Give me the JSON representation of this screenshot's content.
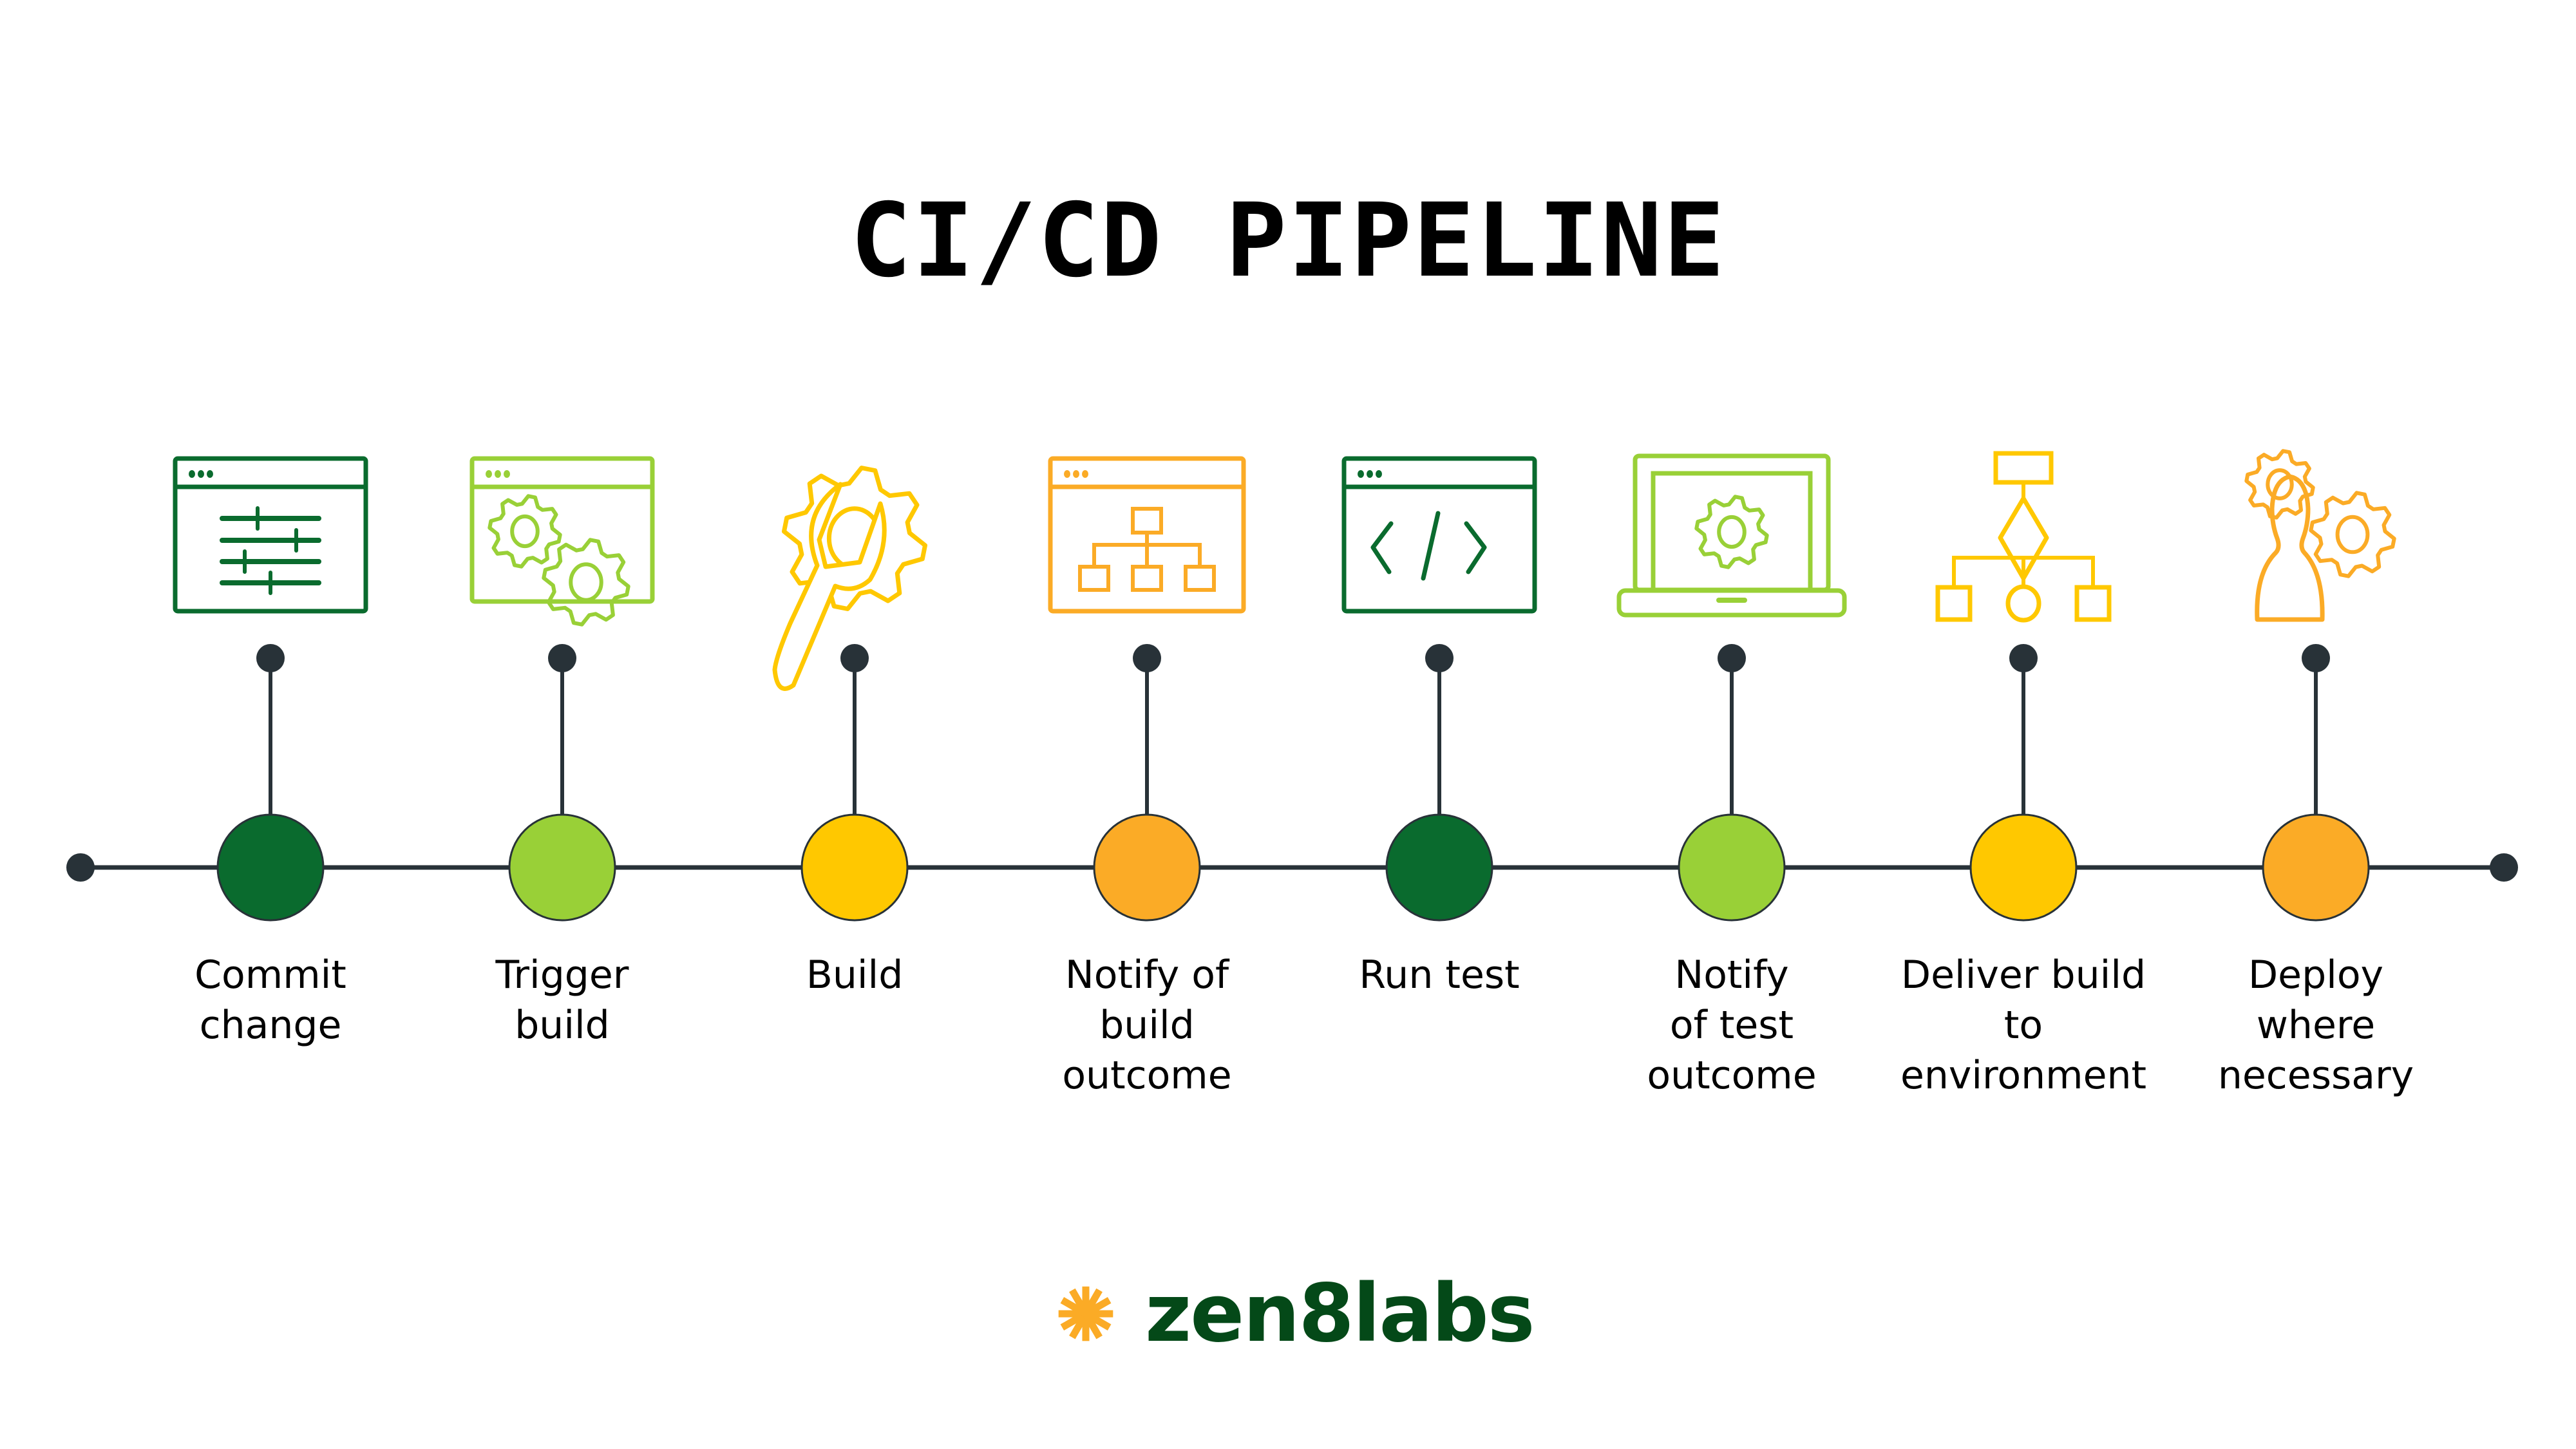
{
  "title": "CI/CD PIPELINE",
  "colors": {
    "dark_green": "#0A6B2E",
    "light_green": "#99D037",
    "yellow": "#FFC800",
    "orange": "#FBAB26",
    "line": "#283238",
    "logo_text": "#044918",
    "logo_star": "#FBAB26"
  },
  "steps": [
    {
      "label_lines": [
        "Commit",
        "change"
      ],
      "color": "dark_green",
      "icon": "settings-window-icon"
    },
    {
      "label_lines": [
        "Trigger",
        "build"
      ],
      "color": "light_green",
      "icon": "gears-window-icon"
    },
    {
      "label_lines": [
        "Build"
      ],
      "color": "yellow",
      "icon": "wrench-gear-icon"
    },
    {
      "label_lines": [
        "Notify of",
        "build",
        "outcome"
      ],
      "color": "orange",
      "icon": "hierarchy-window-icon"
    },
    {
      "label_lines": [
        "Run test"
      ],
      "color": "dark_green",
      "icon": "code-window-icon"
    },
    {
      "label_lines": [
        "Notify",
        "of test",
        "outcome"
      ],
      "color": "light_green",
      "icon": "laptop-gear-icon"
    },
    {
      "label_lines": [
        "Deliver build",
        "to",
        "environment"
      ],
      "color": "yellow",
      "icon": "flowchart-icon"
    },
    {
      "label_lines": [
        "Deploy",
        "where",
        "necessary"
      ],
      "color": "orange",
      "icon": "user-gears-icon"
    }
  ],
  "logo": {
    "text": "zen8labs",
    "icon": "asterisk-icon"
  }
}
